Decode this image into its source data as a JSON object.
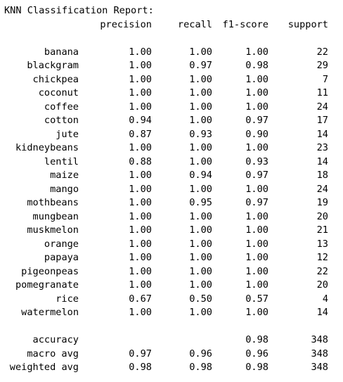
{
  "report": {
    "title": "KNN Classification Report:",
    "headers": {
      "precision": "precision",
      "recall": "recall",
      "f1": "f1-score",
      "support": "support"
    },
    "rows": [
      {
        "label": "banana",
        "precision": "1.00",
        "recall": "1.00",
        "f1": "1.00",
        "support": "22"
      },
      {
        "label": "blackgram",
        "precision": "1.00",
        "recall": "0.97",
        "f1": "0.98",
        "support": "29"
      },
      {
        "label": "chickpea",
        "precision": "1.00",
        "recall": "1.00",
        "f1": "1.00",
        "support": "7"
      },
      {
        "label": "coconut",
        "precision": "1.00",
        "recall": "1.00",
        "f1": "1.00",
        "support": "11"
      },
      {
        "label": "coffee",
        "precision": "1.00",
        "recall": "1.00",
        "f1": "1.00",
        "support": "24"
      },
      {
        "label": "cotton",
        "precision": "0.94",
        "recall": "1.00",
        "f1": "0.97",
        "support": "17"
      },
      {
        "label": "jute",
        "precision": "0.87",
        "recall": "0.93",
        "f1": "0.90",
        "support": "14"
      },
      {
        "label": "kidneybeans",
        "precision": "1.00",
        "recall": "1.00",
        "f1": "1.00",
        "support": "23"
      },
      {
        "label": "lentil",
        "precision": "0.88",
        "recall": "1.00",
        "f1": "0.93",
        "support": "14"
      },
      {
        "label": "maize",
        "precision": "1.00",
        "recall": "0.94",
        "f1": "0.97",
        "support": "18"
      },
      {
        "label": "mango",
        "precision": "1.00",
        "recall": "1.00",
        "f1": "1.00",
        "support": "24"
      },
      {
        "label": "mothbeans",
        "precision": "1.00",
        "recall": "0.95",
        "f1": "0.97",
        "support": "19"
      },
      {
        "label": "mungbean",
        "precision": "1.00",
        "recall": "1.00",
        "f1": "1.00",
        "support": "20"
      },
      {
        "label": "muskmelon",
        "precision": "1.00",
        "recall": "1.00",
        "f1": "1.00",
        "support": "21"
      },
      {
        "label": "orange",
        "precision": "1.00",
        "recall": "1.00",
        "f1": "1.00",
        "support": "13"
      },
      {
        "label": "papaya",
        "precision": "1.00",
        "recall": "1.00",
        "f1": "1.00",
        "support": "12"
      },
      {
        "label": "pigeonpeas",
        "precision": "1.00",
        "recall": "1.00",
        "f1": "1.00",
        "support": "22"
      },
      {
        "label": "pomegranate",
        "precision": "1.00",
        "recall": "1.00",
        "f1": "1.00",
        "support": "20"
      },
      {
        "label": "rice",
        "precision": "0.67",
        "recall": "0.50",
        "f1": "0.57",
        "support": "4"
      },
      {
        "label": "watermelon",
        "precision": "1.00",
        "recall": "1.00",
        "f1": "1.00",
        "support": "14"
      }
    ],
    "summary": [
      {
        "label": "accuracy",
        "precision": "",
        "recall": "",
        "f1": "0.98",
        "support": "348"
      },
      {
        "label": "macro avg",
        "precision": "0.97",
        "recall": "0.96",
        "f1": "0.96",
        "support": "348"
      },
      {
        "label": "weighted avg",
        "precision": "0.98",
        "recall": "0.98",
        "f1": "0.98",
        "support": "348"
      }
    ]
  }
}
